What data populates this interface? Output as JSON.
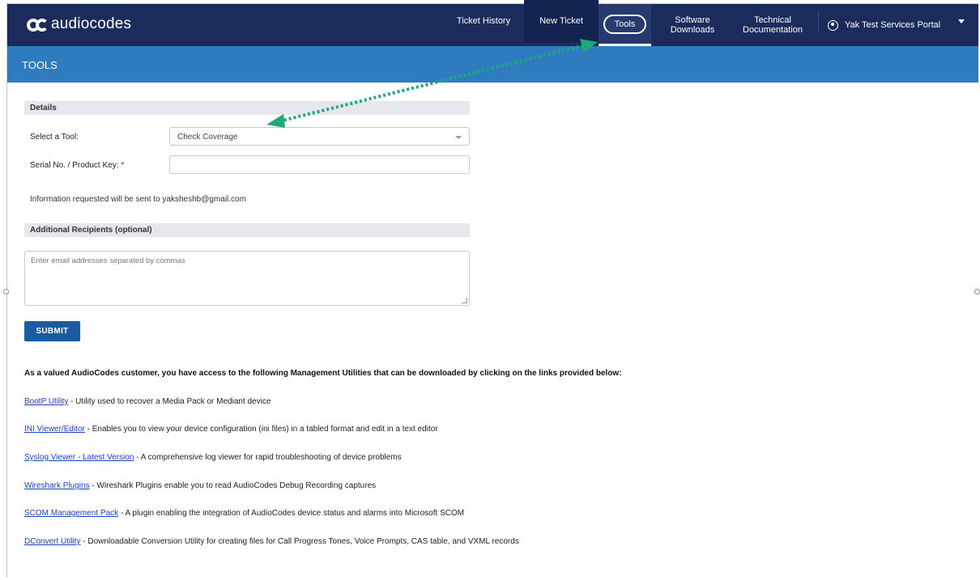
{
  "brand": {
    "name": "audiocodes"
  },
  "nav": {
    "ticket_history": "Ticket History",
    "new_ticket": "New Ticket",
    "tools": "Tools",
    "software_downloads_1": "Software",
    "software_downloads_2": "Downloads",
    "tech_docs_1": "Technical",
    "tech_docs_2": "Documentation",
    "user": "Yak Test Services Portal"
  },
  "page_title": "TOOLS",
  "details": {
    "header": "Details",
    "select_tool_label": "Select a Tool:",
    "select_tool_value": "Check Coverage",
    "serial_label": "Serial No. / Product Key:",
    "serial_required": "*",
    "serial_value": "",
    "info_text": "Information requested will be sent to yaksheshb@gmail.com"
  },
  "recipients": {
    "header": "Additional Recipients (optional)",
    "placeholder": "Enter email addresses separated by commas"
  },
  "submit_label": "SUBMIT",
  "utilities_intro": "As a valued AudioCodes customer, you have access to the following Management Utilities that can be downloaded by clicking on the links provided below:",
  "utilities": [
    {
      "link": "BootP Utility",
      "desc": " - Utility used to recover a Media Pack or Mediant device"
    },
    {
      "link": "INI Viewer/Editor",
      "desc": " - Enables you to view your device configuration (ini files) in a tabled format and edit in a text editor"
    },
    {
      "link": "Syslog Viewer - Latest Version",
      "desc": " - A comprehensive log viewer for rapid troubleshooting of device problems"
    },
    {
      "link": "Wireshark Plugins",
      "desc": " - Wireshark Plugins enable you to read AudioCodes Debug Recording captures"
    },
    {
      "link": "SCOM Management Pack",
      "desc": " - A plugin enabling the integration of AudioCodes device status and alarms into Microsoft SCOM"
    },
    {
      "link": "DConvert Utility",
      "desc": " - Downloadable Conversion Utility for creating files for Call Progress Tones, Voice Prompts, CAS table, and VXML records"
    }
  ],
  "colors": {
    "nav_bg": "#1b2b5c",
    "subbar_bg": "#2f7bc0",
    "submit_bg": "#1d5a9e",
    "annotation": "#1fa87a"
  }
}
